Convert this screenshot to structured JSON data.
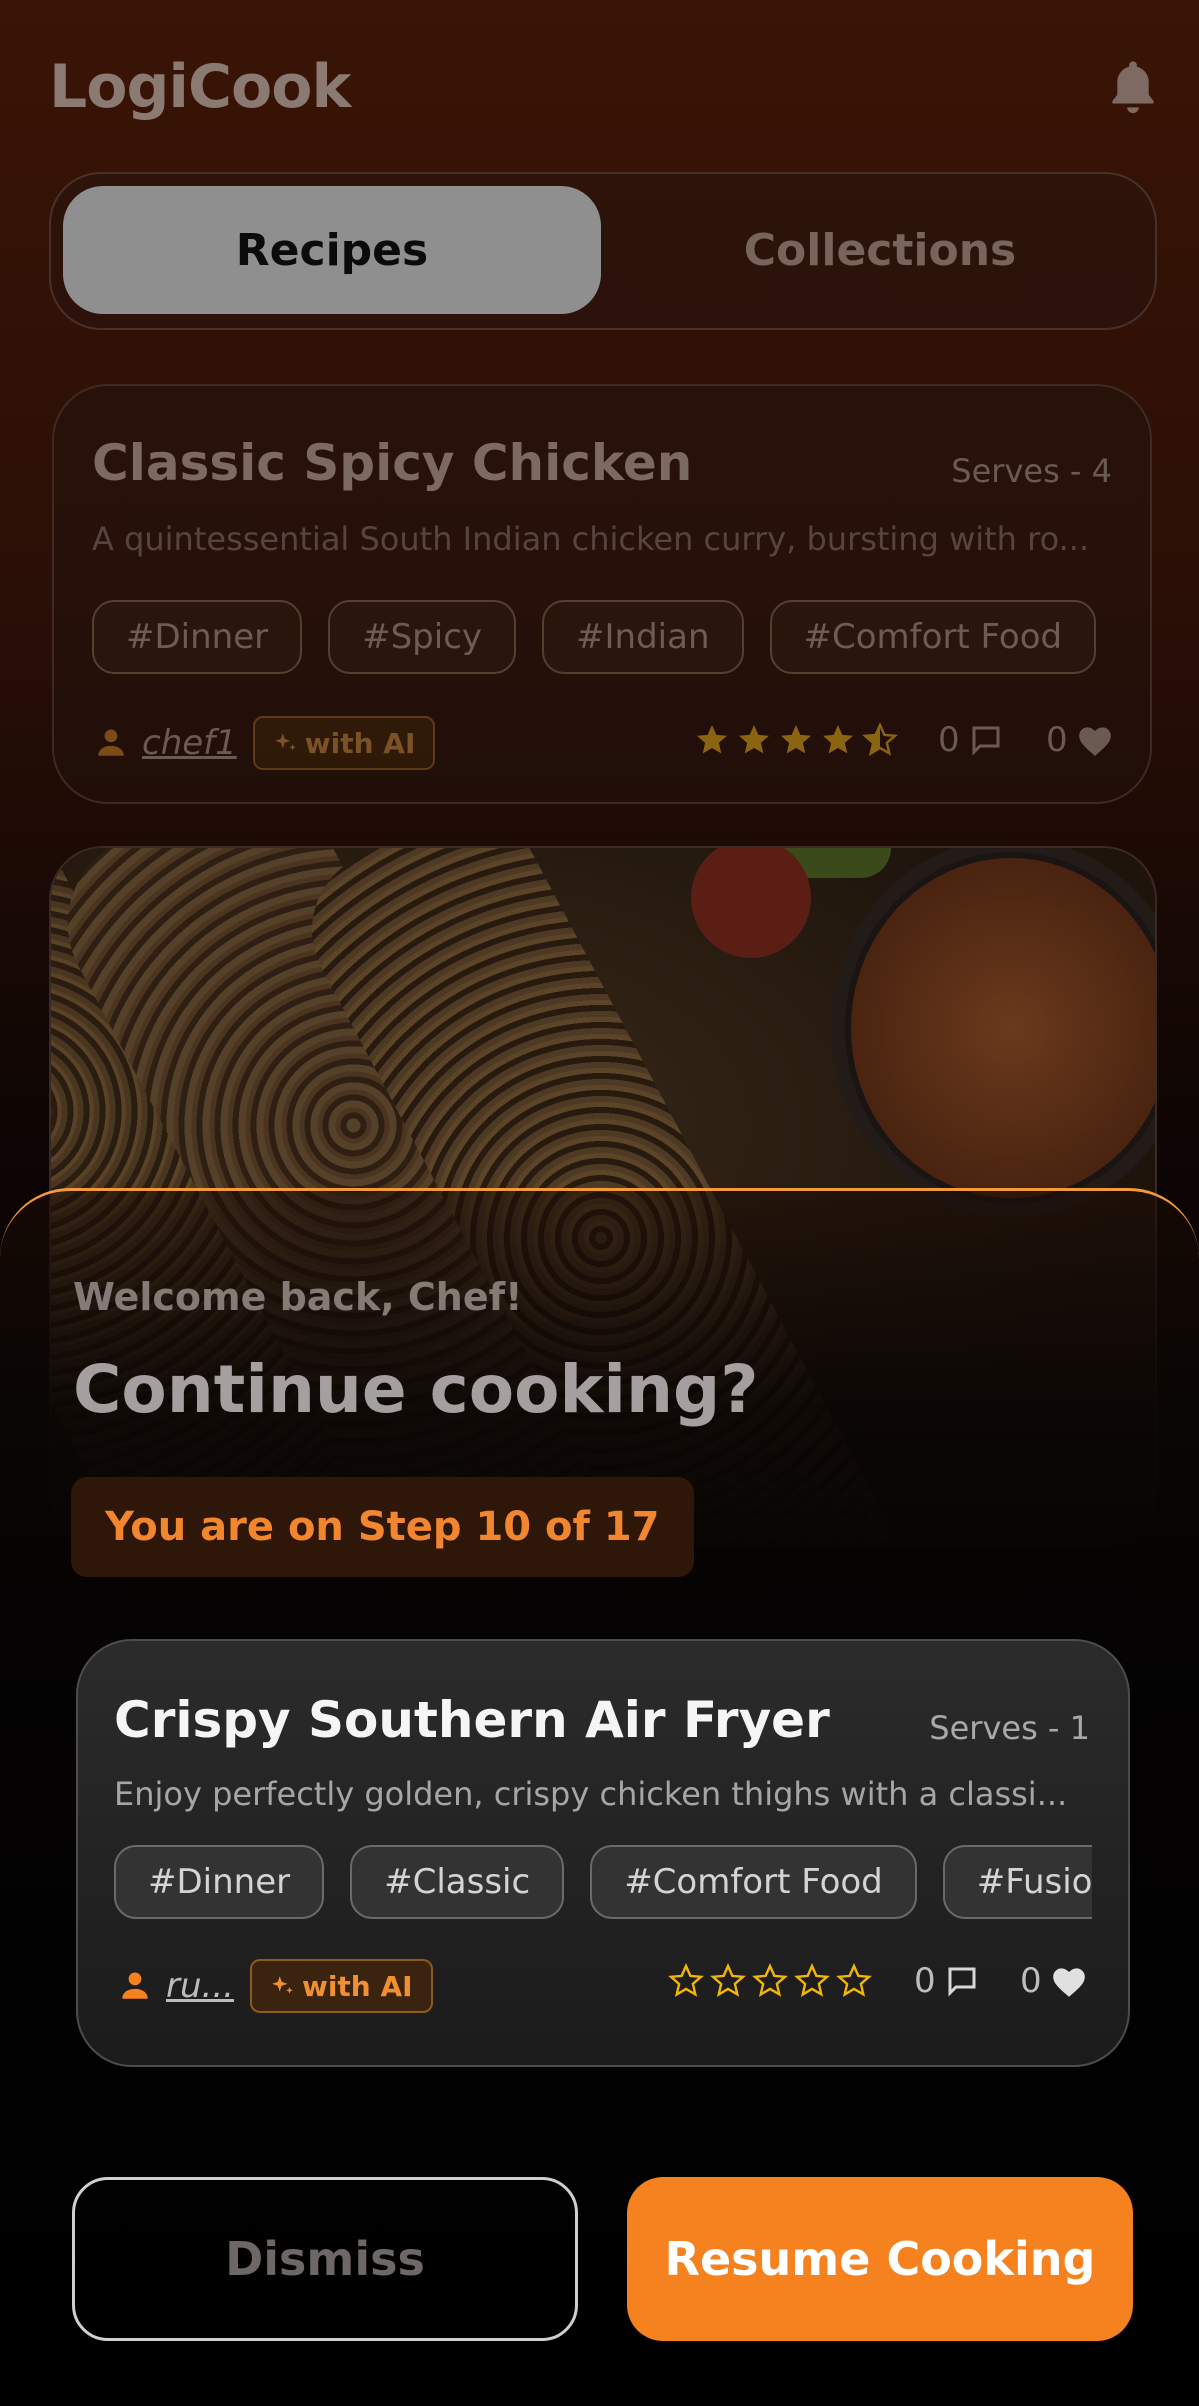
{
  "app": {
    "title": "LogiCook",
    "icons": {
      "notifications": "bell-icon"
    }
  },
  "tabs": [
    {
      "label": "Recipes",
      "active": true
    },
    {
      "label": "Collections",
      "active": false
    }
  ],
  "background_recipe": {
    "title": "Classic Spicy Chicken",
    "serves": "Serves - 4",
    "description": "A quintessential South Indian chicken curry, bursting with ro...",
    "tags": [
      "#Dinner",
      "#Spicy",
      "#Indian",
      "#Comfort Food",
      "#"
    ],
    "author": "chef1",
    "ai_badge": "with AI",
    "rating": 4.5,
    "comments": "0",
    "likes": "0"
  },
  "modal": {
    "welcome": "Welcome back, Chef!",
    "title": "Continue cooking?",
    "step": "You are on Step 10 of 17",
    "recipe": {
      "title": "Crispy Southern Air Fryer",
      "serves": "Serves - 1",
      "description": "Enjoy perfectly golden, crispy chicken thighs with a classi...",
      "tags": [
        "#Dinner",
        "#Classic",
        "#Comfort Food",
        "#Fusion"
      ],
      "author": "ru...",
      "ai_badge": "with AI",
      "rating": 0,
      "comments": "0",
      "likes": "0"
    },
    "dismiss_label": "Dismiss",
    "resume_label": "Resume Cooking"
  },
  "colors": {
    "accent": "#F5821F",
    "star_dim": "#8a6410",
    "star_bright": "#F2B705"
  }
}
